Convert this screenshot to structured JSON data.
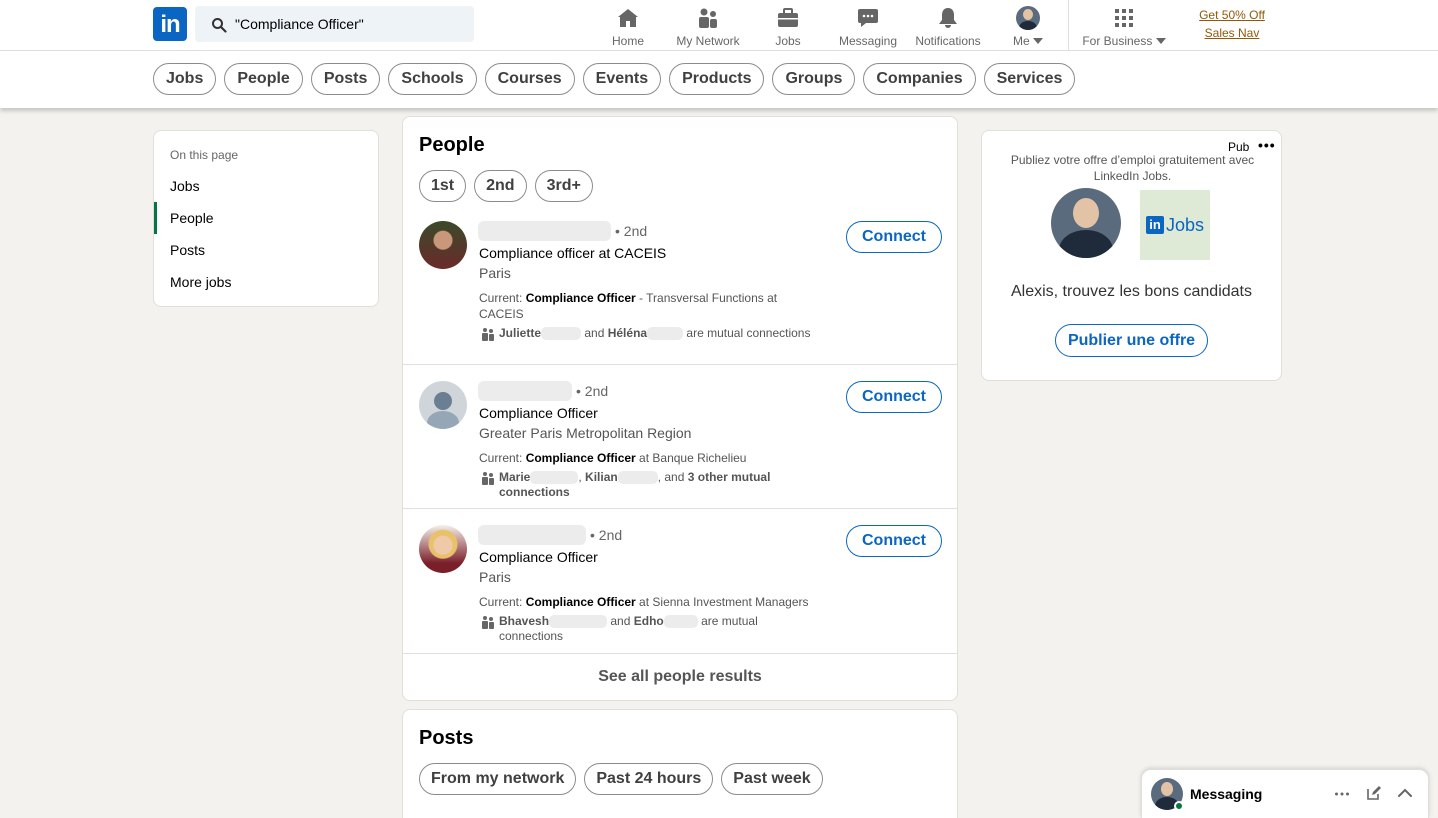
{
  "nav": {
    "search_value": "\"Compliance Officer\"",
    "items": [
      {
        "label": "Home",
        "icon": "home-icon"
      },
      {
        "label": "My Network",
        "icon": "network-icon"
      },
      {
        "label": "Jobs",
        "icon": "briefcase-icon"
      },
      {
        "label": "Messaging",
        "icon": "messaging-icon"
      },
      {
        "label": "Notifications",
        "icon": "bell-icon"
      },
      {
        "label": "Me",
        "icon": "avatar"
      },
      {
        "label": "For Business",
        "icon": "grid-icon"
      }
    ],
    "promo_line1": "Get 50% Off",
    "promo_line2": "Sales Nav"
  },
  "filters": [
    "Jobs",
    "People",
    "Posts",
    "Schools",
    "Courses",
    "Events",
    "Products",
    "Groups",
    "Companies",
    "Services"
  ],
  "sidebar": {
    "heading": "On this page",
    "items": [
      {
        "label": "Jobs"
      },
      {
        "label": "People",
        "active": true
      },
      {
        "label": "Posts"
      },
      {
        "label": "More jobs"
      }
    ]
  },
  "people": {
    "title": "People",
    "degree_filters": [
      "1st",
      "2nd",
      "3rd+"
    ],
    "results": [
      {
        "degree": "• 2nd",
        "title": "Compliance officer at CACEIS",
        "location": "Paris",
        "current_prefix": "Current: ",
        "current_bold": "Compliance Officer",
        "current_rest": " - Transversal Functions at CACEIS",
        "mutual_a": "Juliette",
        "mutual_mid": " and ",
        "mutual_b": "Héléna",
        "mutual_end": " are mutual connections",
        "connect": "Connect"
      },
      {
        "degree": "• 2nd",
        "title": "Compliance Officer",
        "location": "Greater Paris Metropolitan Region",
        "current_prefix": "Current: ",
        "current_bold": "Compliance Officer",
        "current_rest": " at Banque Richelieu",
        "mutual_a": "Marie",
        "mutual_mid": ", ",
        "mutual_b": "Kilian",
        "mutual_end": ", and ",
        "mutual_bold_end": "3 other mutual connections",
        "connect": "Connect"
      },
      {
        "degree": "• 2nd",
        "title": "Compliance Officer",
        "location": "Paris",
        "current_prefix": "Current: ",
        "current_bold": "Compliance Officer",
        "current_rest": " at Sienna Investment Managers",
        "mutual_a": "Bhavesh",
        "mutual_mid": " and ",
        "mutual_b": "Edho",
        "mutual_end": " are mutual connections",
        "connect": "Connect"
      }
    ],
    "see_all": "See all people results"
  },
  "posts": {
    "title": "Posts",
    "filters": [
      "From my network",
      "Past 24 hours",
      "Past week"
    ]
  },
  "ad": {
    "pub": "Pub",
    "text": "Publiez votre offre d’emploi gratuitement avec LinkedIn Jobs.",
    "logo_word": "Jobs",
    "headline": "Alexis, trouvez les bons candidats",
    "button": "Publier une offre"
  },
  "messaging": {
    "label": "Messaging"
  },
  "colors": {
    "brand": "#0a66c2",
    "active": "#057642",
    "promo": "#915907",
    "background": "#f3f2ef"
  }
}
